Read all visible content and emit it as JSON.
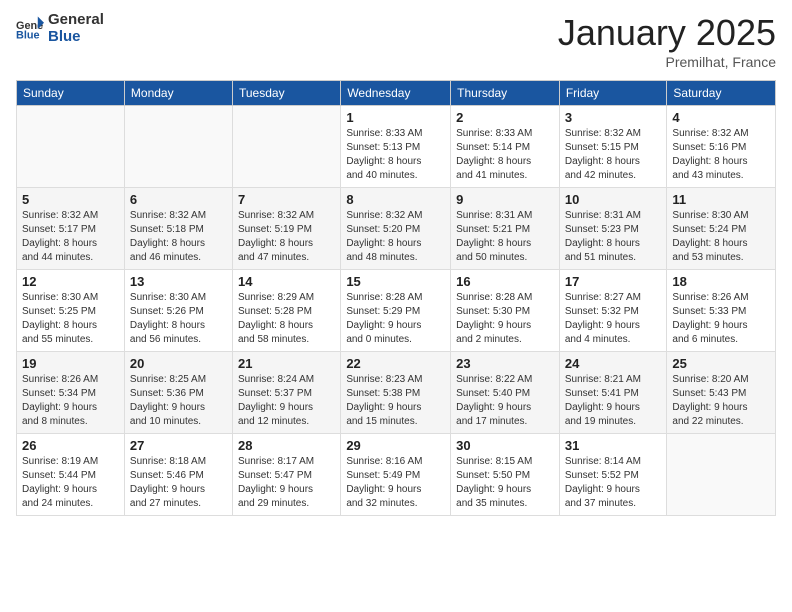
{
  "header": {
    "logo_general": "General",
    "logo_blue": "Blue",
    "month": "January 2025",
    "location": "Premilhat, France"
  },
  "weekdays": [
    "Sunday",
    "Monday",
    "Tuesday",
    "Wednesday",
    "Thursday",
    "Friday",
    "Saturday"
  ],
  "weeks": [
    [
      {
        "day": "",
        "info": ""
      },
      {
        "day": "",
        "info": ""
      },
      {
        "day": "",
        "info": ""
      },
      {
        "day": "1",
        "info": "Sunrise: 8:33 AM\nSunset: 5:13 PM\nDaylight: 8 hours\nand 40 minutes."
      },
      {
        "day": "2",
        "info": "Sunrise: 8:33 AM\nSunset: 5:14 PM\nDaylight: 8 hours\nand 41 minutes."
      },
      {
        "day": "3",
        "info": "Sunrise: 8:32 AM\nSunset: 5:15 PM\nDaylight: 8 hours\nand 42 minutes."
      },
      {
        "day": "4",
        "info": "Sunrise: 8:32 AM\nSunset: 5:16 PM\nDaylight: 8 hours\nand 43 minutes."
      }
    ],
    [
      {
        "day": "5",
        "info": "Sunrise: 8:32 AM\nSunset: 5:17 PM\nDaylight: 8 hours\nand 44 minutes."
      },
      {
        "day": "6",
        "info": "Sunrise: 8:32 AM\nSunset: 5:18 PM\nDaylight: 8 hours\nand 46 minutes."
      },
      {
        "day": "7",
        "info": "Sunrise: 8:32 AM\nSunset: 5:19 PM\nDaylight: 8 hours\nand 47 minutes."
      },
      {
        "day": "8",
        "info": "Sunrise: 8:32 AM\nSunset: 5:20 PM\nDaylight: 8 hours\nand 48 minutes."
      },
      {
        "day": "9",
        "info": "Sunrise: 8:31 AM\nSunset: 5:21 PM\nDaylight: 8 hours\nand 50 minutes."
      },
      {
        "day": "10",
        "info": "Sunrise: 8:31 AM\nSunset: 5:23 PM\nDaylight: 8 hours\nand 51 minutes."
      },
      {
        "day": "11",
        "info": "Sunrise: 8:30 AM\nSunset: 5:24 PM\nDaylight: 8 hours\nand 53 minutes."
      }
    ],
    [
      {
        "day": "12",
        "info": "Sunrise: 8:30 AM\nSunset: 5:25 PM\nDaylight: 8 hours\nand 55 minutes."
      },
      {
        "day": "13",
        "info": "Sunrise: 8:30 AM\nSunset: 5:26 PM\nDaylight: 8 hours\nand 56 minutes."
      },
      {
        "day": "14",
        "info": "Sunrise: 8:29 AM\nSunset: 5:28 PM\nDaylight: 8 hours\nand 58 minutes."
      },
      {
        "day": "15",
        "info": "Sunrise: 8:28 AM\nSunset: 5:29 PM\nDaylight: 9 hours\nand 0 minutes."
      },
      {
        "day": "16",
        "info": "Sunrise: 8:28 AM\nSunset: 5:30 PM\nDaylight: 9 hours\nand 2 minutes."
      },
      {
        "day": "17",
        "info": "Sunrise: 8:27 AM\nSunset: 5:32 PM\nDaylight: 9 hours\nand 4 minutes."
      },
      {
        "day": "18",
        "info": "Sunrise: 8:26 AM\nSunset: 5:33 PM\nDaylight: 9 hours\nand 6 minutes."
      }
    ],
    [
      {
        "day": "19",
        "info": "Sunrise: 8:26 AM\nSunset: 5:34 PM\nDaylight: 9 hours\nand 8 minutes."
      },
      {
        "day": "20",
        "info": "Sunrise: 8:25 AM\nSunset: 5:36 PM\nDaylight: 9 hours\nand 10 minutes."
      },
      {
        "day": "21",
        "info": "Sunrise: 8:24 AM\nSunset: 5:37 PM\nDaylight: 9 hours\nand 12 minutes."
      },
      {
        "day": "22",
        "info": "Sunrise: 8:23 AM\nSunset: 5:38 PM\nDaylight: 9 hours\nand 15 minutes."
      },
      {
        "day": "23",
        "info": "Sunrise: 8:22 AM\nSunset: 5:40 PM\nDaylight: 9 hours\nand 17 minutes."
      },
      {
        "day": "24",
        "info": "Sunrise: 8:21 AM\nSunset: 5:41 PM\nDaylight: 9 hours\nand 19 minutes."
      },
      {
        "day": "25",
        "info": "Sunrise: 8:20 AM\nSunset: 5:43 PM\nDaylight: 9 hours\nand 22 minutes."
      }
    ],
    [
      {
        "day": "26",
        "info": "Sunrise: 8:19 AM\nSunset: 5:44 PM\nDaylight: 9 hours\nand 24 minutes."
      },
      {
        "day": "27",
        "info": "Sunrise: 8:18 AM\nSunset: 5:46 PM\nDaylight: 9 hours\nand 27 minutes."
      },
      {
        "day": "28",
        "info": "Sunrise: 8:17 AM\nSunset: 5:47 PM\nDaylight: 9 hours\nand 29 minutes."
      },
      {
        "day": "29",
        "info": "Sunrise: 8:16 AM\nSunset: 5:49 PM\nDaylight: 9 hours\nand 32 minutes."
      },
      {
        "day": "30",
        "info": "Sunrise: 8:15 AM\nSunset: 5:50 PM\nDaylight: 9 hours\nand 35 minutes."
      },
      {
        "day": "31",
        "info": "Sunrise: 8:14 AM\nSunset: 5:52 PM\nDaylight: 9 hours\nand 37 minutes."
      },
      {
        "day": "",
        "info": ""
      }
    ]
  ]
}
